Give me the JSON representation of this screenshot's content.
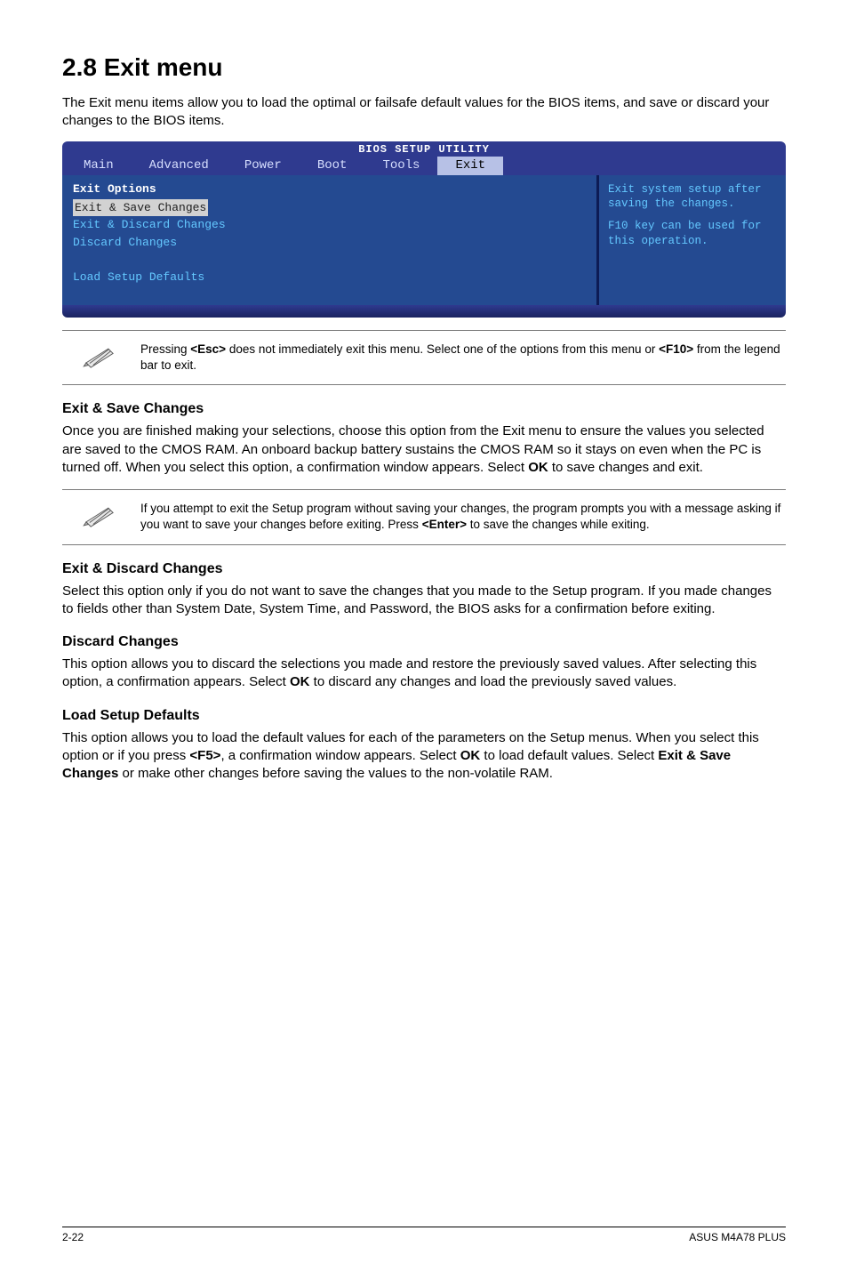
{
  "heading": "2.8        Exit menu",
  "intro": "The Exit menu items allow you to load the optimal or failsafe default values for the BIOS items, and save or discard your changes to the BIOS items.",
  "bios": {
    "title": "BIOS SETUP UTILITY",
    "tabs": [
      "Main",
      "Advanced",
      "Power",
      "Boot",
      "Tools",
      "Exit"
    ],
    "selected_tab_index": 5,
    "left_title": "Exit Options",
    "items": [
      "Exit & Save Changes",
      "Exit & Discard Changes",
      "Discard Changes",
      "",
      "Load Setup Defaults"
    ],
    "selected_item_index": 0,
    "help1": "Exit system setup after saving the changes.",
    "help2": "F10 key can be used for this operation."
  },
  "note1": {
    "prefix": "Pressing ",
    "key1": "<Esc>",
    "mid": " does not immediately exit this menu. Select one of the options from this menu or ",
    "key2": "<F10>",
    "suffix": " from the legend bar to exit."
  },
  "sections": {
    "esc_title": "Exit & Save Changes",
    "esc_body_a": "Once you are finished making your selections, choose this option from the Exit menu to ensure the values you selected are saved to the CMOS RAM. An onboard backup battery sustains the CMOS RAM so it stays on even when the PC is turned off. When you select this option, a confirmation window appears. Select ",
    "esc_body_ok": "OK",
    "esc_body_b": " to save changes and exit.",
    "edc_title": "Exit & Discard Changes",
    "edc_body": "Select this option only if you do not want to save the changes that you  made to the Setup program. If you made changes to fields other than System Date, System Time, and Password, the BIOS asks for a confirmation before exiting.",
    "dc_title": "Discard Changes",
    "dc_body_a": "This option allows you to discard the selections you made and restore the previously saved values. After selecting this option, a confirmation appears. Select ",
    "dc_body_ok": "OK",
    "dc_body_b": " to discard any changes and load the previously saved values.",
    "lsd_title": "Load Setup Defaults",
    "lsd_body_a": "This option allows you to load the default values for each of the parameters on the Setup menus. When you select this option or if you press ",
    "lsd_f5": "<F5>",
    "lsd_body_b": ", a confirmation window appears. Select ",
    "lsd_ok": "OK",
    "lsd_body_c": " to load default values. Select ",
    "lsd_esc": "Exit & Save Changes",
    "lsd_body_d": " or make other changes before saving the values to the non-volatile RAM."
  },
  "note2": {
    "prefix": " If you attempt to exit the Setup program without saving your changes, the program prompts you with a message asking if you want to save your changes before exiting. Press ",
    "key": "<Enter>",
    "suffix": " to save the  changes while exiting."
  },
  "footer": {
    "left": "2-22",
    "right": "ASUS M4A78 PLUS"
  }
}
